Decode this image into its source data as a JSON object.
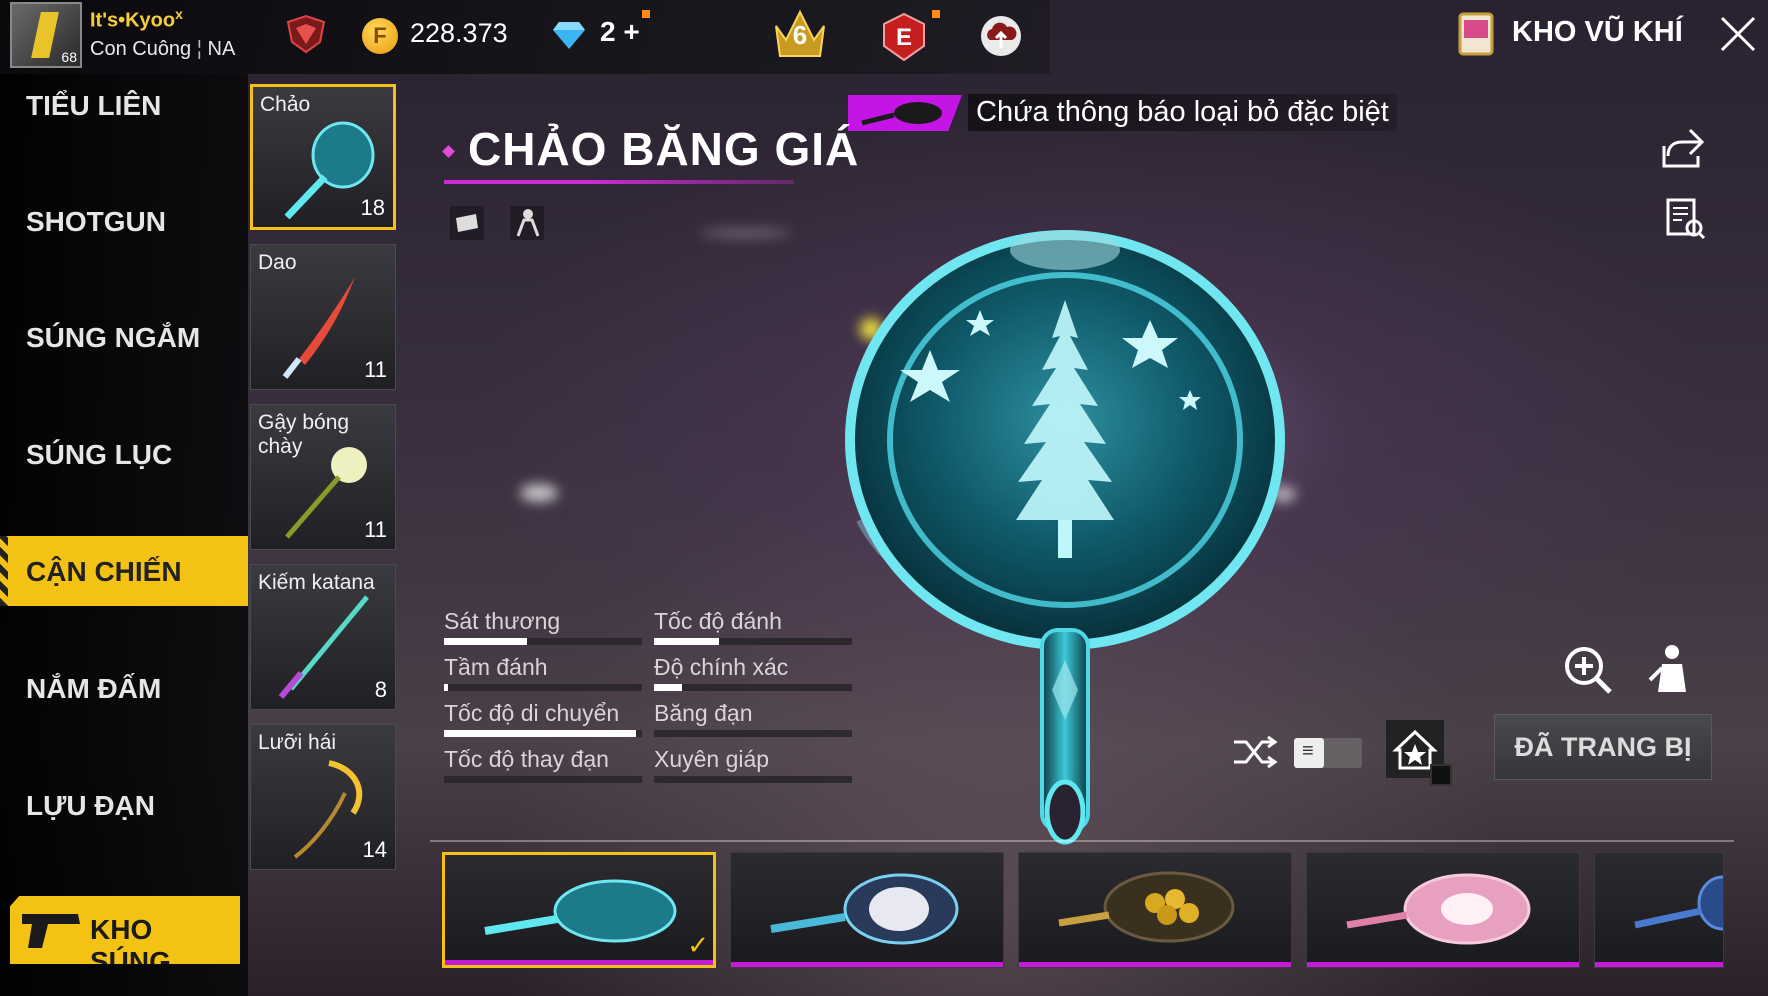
{
  "player": {
    "name": "It's•Kyoo",
    "name_mark": "x",
    "guild": "Con Cuông",
    "region": "NA",
    "level": "68"
  },
  "currency": {
    "coins": "228.373",
    "coin_symbol": "F",
    "gems": "2",
    "gems_plus": "+"
  },
  "badges": {
    "rank_level": "6",
    "elite_letter": "E"
  },
  "header": {
    "title": "KHO VŨ KHÍ"
  },
  "categories": [
    {
      "label": "TIỂU LIÊN",
      "active": false
    },
    {
      "label": "SHOTGUN",
      "active": false
    },
    {
      "label": "SÚNG NGẮM",
      "active": false
    },
    {
      "label": "SÚNG LỤC",
      "active": false
    },
    {
      "label": "CẬN CHIẾN",
      "active": true
    },
    {
      "label": "NẮM ĐẤM",
      "active": false
    },
    {
      "label": "LỰU ĐẠN",
      "active": false
    }
  ],
  "kho_sung": {
    "label": "KHO SÚNG"
  },
  "items": [
    {
      "name": "Chảo",
      "count": "18",
      "active": true
    },
    {
      "name": "Dao",
      "count": "11",
      "active": false
    },
    {
      "name": "Gậy bóng chày",
      "count": "11",
      "active": false
    },
    {
      "name": "Kiếm katana",
      "count": "8",
      "active": false
    },
    {
      "name": "Lưỡi hái",
      "count": "14",
      "active": false
    }
  ],
  "notice": {
    "text": "Chứa thông báo loại bỏ đặc biệt"
  },
  "weapon": {
    "title": "CHẢO BĂNG GIÁ"
  },
  "stats": [
    {
      "label": "Sát thương",
      "value": 0.42
    },
    {
      "label": "Tốc độ đánh",
      "value": 0.33
    },
    {
      "label": "Tầm đánh",
      "value": 0.02
    },
    {
      "label": "Độ chính xác",
      "value": 0.14
    },
    {
      "label": "Tốc độ di chuyển",
      "value": 0.97
    },
    {
      "label": "Băng đạn",
      "value": 0
    },
    {
      "label": "Tốc độ thay đạn",
      "value": 0
    },
    {
      "label": "Xuyên giáp",
      "value": 0
    }
  ],
  "actions": {
    "equipped_label": "ĐÃ TRANG BỊ"
  },
  "colors": {
    "accent_yellow": "#f4c214",
    "accent_magenta": "#c515e6",
    "ice": "#5fe8f0"
  },
  "skins": [
    {
      "name": "ice-pan",
      "active": true
    },
    {
      "name": "graffiti-pan",
      "active": false
    },
    {
      "name": "gold-coin-pan",
      "active": false
    },
    {
      "name": "pink-pan",
      "active": false
    },
    {
      "name": "blue-pan-partial",
      "active": false
    }
  ]
}
